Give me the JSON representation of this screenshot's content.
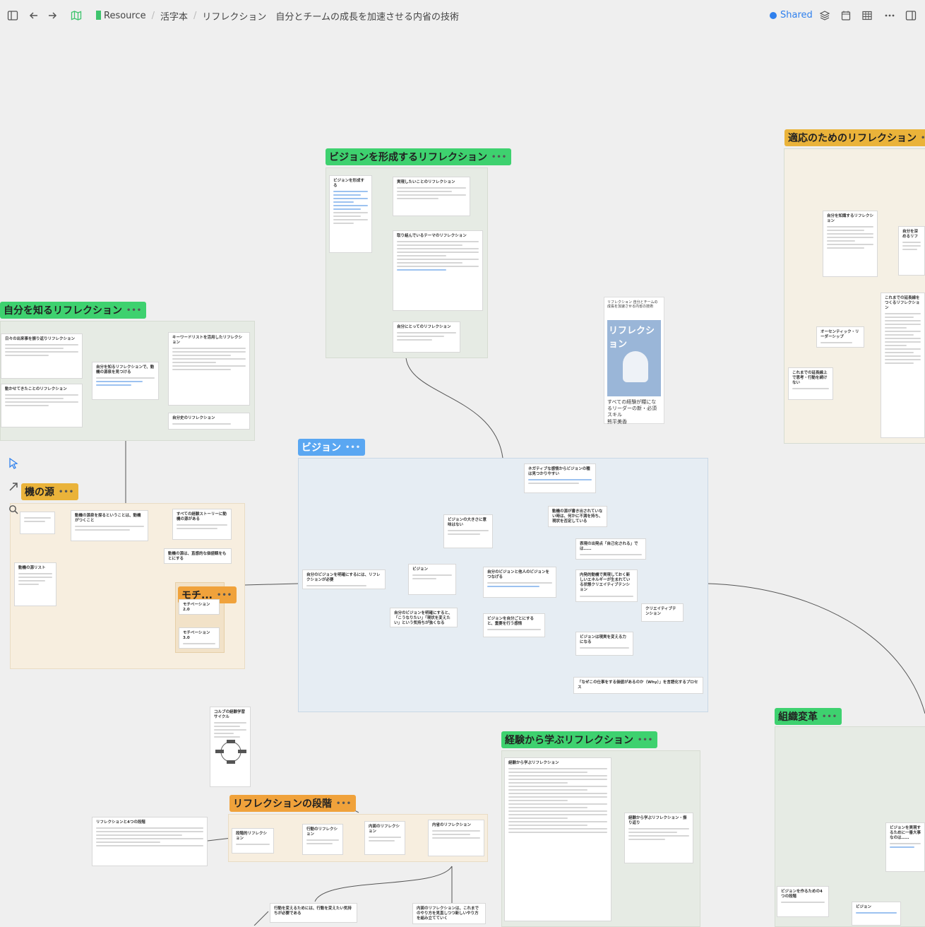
{
  "topbar": {
    "crumbs": [
      "Resource",
      "活字本",
      "リフレクション　自分とチームの成長を加速させる内省の技術"
    ],
    "shared_label": "Shared",
    "colors": {
      "accent": "#2f80ed",
      "resource_mark": "#3ec46d"
    }
  },
  "groups": {
    "vision_forming": "ビジョンを形成するリフレクション",
    "self_knowing": "自分を知るリフレクション",
    "vision": "ビジョン",
    "source": "機の源",
    "motivation": "モチ...",
    "adaptation": "適応のためのリフレクション",
    "experience": "経験から学ぶリフレクション",
    "stages": "リフレクションの段階",
    "org_change": "組織変革"
  },
  "cards": {
    "vf_1": "ビジョンを形成する",
    "vf_2": "実現したいことのリフレクション",
    "vf_3": "取り組んでいるテーマのリフレクション",
    "vf_4": "自分にとってのリフレクション",
    "sk_1": "日々の出来事を振り返りリフレクション",
    "sk_2": "自分を知るリフレクションで、動機の源泉を見つける",
    "sk_3": "キーワードリストを活用したリフレクション",
    "sk_4": "動かせてきたことのリフレクション",
    "sk_5": "自分史のリフレクション",
    "v_1": "ネガティブな感情からビジョンの種は見つかりやすい",
    "v_2": "動機の源が書き出されていない時は、何かに不満を持ち、現状を否定している",
    "v_3": "ビジョンの大きさに意味はない",
    "v_4": "自分のビジョンを明確にするには、リフレクションが必要",
    "v_5": "ビジョン",
    "v_6": "自分のビジョンと他人のビジョンをつなげる",
    "v_7": "表現の出発点「自己化される」では……",
    "v_8": "内発的動機で実現しておく新しいエネルギーが生まれている状態クリエイティブテンション",
    "v_9": "クリエイティブテンション",
    "v_10": "自分のビジョンを明確にすると、「こうなりたい」「現状を変えたい」という気持ちが強くなる",
    "v_11": "ビジョンを自分ごとにすると、重要を行う感情",
    "v_12": "ビジョンは現実を変える力になる",
    "v_13": "「なぜこの仕事をする価値があるのか（Why）」を言語化するプロセス",
    "s_1": "動機の源泉を探るということは、動機がつくこと",
    "s_2": "すべての経験ストーリーに動機の源がある",
    "s_3": "動機の源は、直感的な価値観をもとにする",
    "s_4": "動機の源リスト",
    "m_1": "モチベーション2.0",
    "m_2": "モチベーション3.0",
    "a_1": "自分を知識するリフレクション",
    "a_2": "自分を深めるリフ",
    "a_3": "オーセンティック・リーダーシップ",
    "a_4": "これまでの延長線上で思考・行動を続けない",
    "a_5": "これまでの延長線をつくるリフレクション",
    "cycle": "コルブの経験学習サイクル",
    "st_0": "リフレクションと4つの段階",
    "st_1": "段階的リフレクション",
    "st_2": "行動のリフレクション",
    "st_3": "内面のリフレクション",
    "st_4": "内省のリフレクション",
    "ex_1": "経験から学ぶリフレクション",
    "ex_2": "経験から学ぶリフレクション・振り返り",
    "oc_1": "ビジョンを実現するために一番大事なのは……",
    "oc_2": "ビジョンを作るための4つの段階",
    "oc_3": "ビジョン",
    "b_1": "行動を変えるためには、行動を変えたい気持ちが必要である",
    "b_2": "内面のリフレクションは、これまでのやり方を見直しつつ新しいやり方を組み立てていく"
  },
  "book": {
    "header": "リフレクション 自分とチームの成長を加速させる内省の技術",
    "title": "リフレクション",
    "subtitle": "自分とチームの成長を加速させる内省の技術",
    "tagline": "すべての経験が糧になるリーダーの新・必須スキル",
    "author": "熊平美香"
  }
}
